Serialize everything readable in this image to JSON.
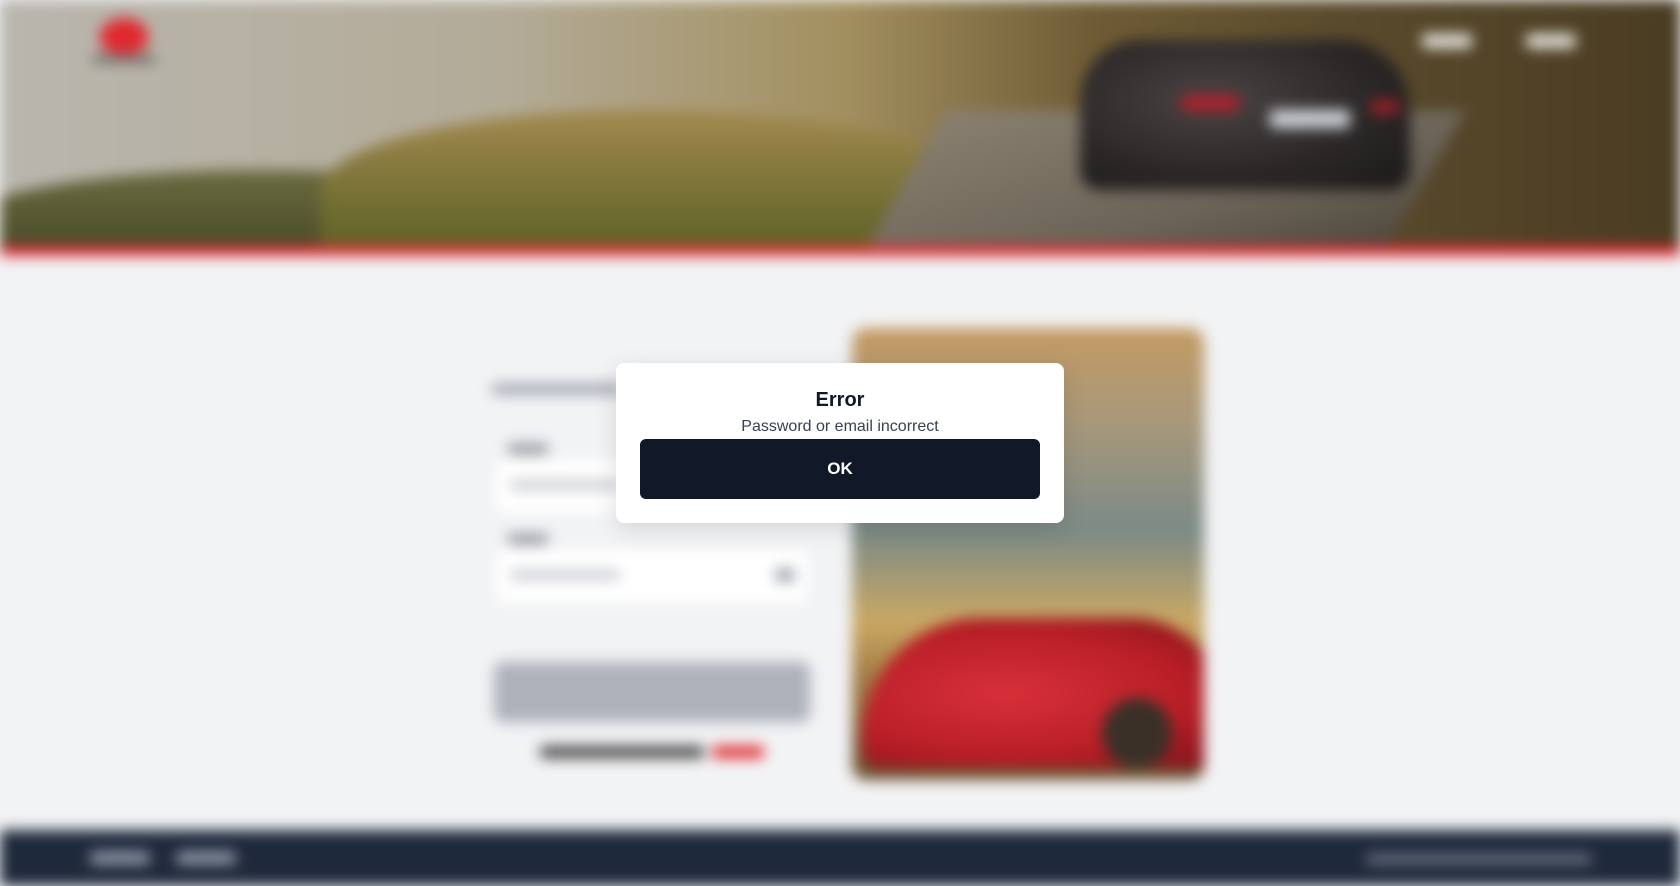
{
  "modal": {
    "title": "Error",
    "message": "Password or email incorrect",
    "ok_label": "OK"
  },
  "colors": {
    "brand_red": "#e0282e",
    "modal_button": "#111827",
    "footer_bg": "#1e293b",
    "page_bg": "#f2f3f5"
  }
}
